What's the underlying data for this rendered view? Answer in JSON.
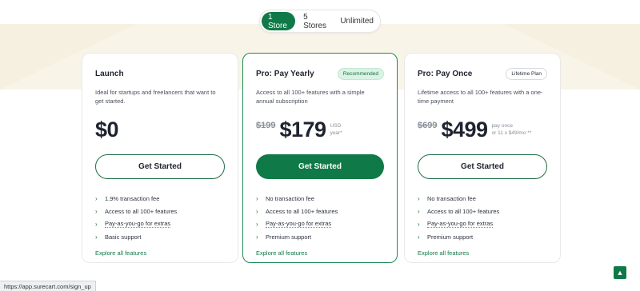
{
  "toggle": {
    "options": [
      "1 Store",
      "5 Stores",
      "Unlimited"
    ]
  },
  "plans": [
    {
      "name": "Launch",
      "description": "Ideal for startups and freelancers that want to get started.",
      "price": "$0",
      "button": "Get Started",
      "features": [
        "1.9% transaction fee",
        "Access to all 100+ features",
        "Pay-as-you-go for extras",
        "Basic support"
      ],
      "explore": "Explore all features"
    },
    {
      "name": "Pro: Pay Yearly",
      "badge": "Recommended",
      "description": "Access to all 100+ features with a simple annual subscription",
      "old_price": "$199",
      "price": "$179",
      "sub1": "USD",
      "sub2": "year*",
      "button": "Get Started",
      "features": [
        "No transaction fee",
        "Access to all 100+ features",
        "Pay-as-you-go for extras",
        "Premium support"
      ],
      "explore": "Explore all features"
    },
    {
      "name": "Pro: Pay Once",
      "badge": "Lifetime Plan",
      "description": "Lifetime access to all 100+ features with a one-time payment",
      "old_price": "$699",
      "price": "$499",
      "sub1": "pay once",
      "sub2": "or 11 x $49/mo **",
      "button": "Get Started",
      "features": [
        "No transaction fee",
        "Access to all 100+ features",
        "Pay-as-you-go for extras",
        "Premium support"
      ],
      "explore": "Explore all features"
    }
  ],
  "status_url": "https://app.surecart.com/sign_up",
  "icons": {
    "chevron": "chevron-right-icon",
    "to_top": "arrow-up-icon"
  },
  "colors": {
    "brand": "#0f7a47",
    "badge_bg": "#d9f3e4"
  }
}
